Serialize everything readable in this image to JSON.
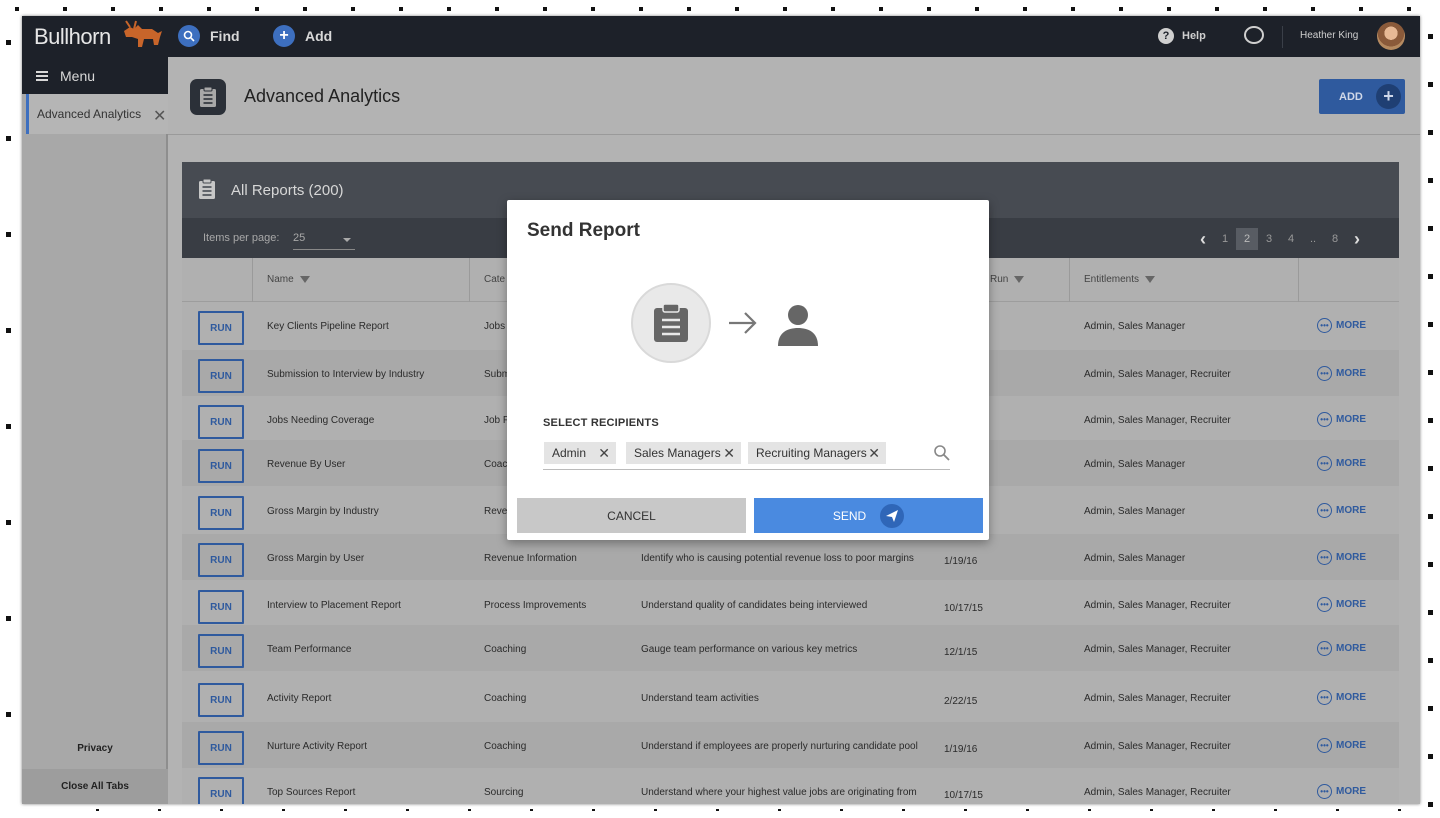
{
  "app": {
    "logo": "Bullhorn",
    "find_label": "Find",
    "add_label": "Add",
    "help_label": "Help",
    "user_name": "Heather King"
  },
  "sidebar": {
    "menu_label": "Menu",
    "active_tab": "Advanced Analytics",
    "privacy_label": "Privacy",
    "close_all_label": "Close All Tabs"
  },
  "header": {
    "title": "Advanced Analytics",
    "add_button": "ADD"
  },
  "panel": {
    "title": "All Reports (200)",
    "items_per_page_label": "Items per page:",
    "items_per_page_value": "25",
    "pager": {
      "pages": [
        "1",
        "2",
        "3",
        "4",
        "..",
        "8"
      ],
      "current": "2"
    },
    "columns": {
      "name": "Name",
      "category": "Cate",
      "last_run": "Run",
      "entitlements": "Entitlements"
    },
    "run_label": "RUN",
    "more_label": "MORE",
    "rows": [
      {
        "name": "Key Clients Pipeline Report",
        "category": "Jobs",
        "description": "",
        "last_run": "",
        "entitlements": "Admin, Sales Manager"
      },
      {
        "name": "Submission to Interview by Industry",
        "category": "Subm",
        "description": "",
        "last_run": "",
        "entitlements": "Admin, Sales Manager, Recruiter"
      },
      {
        "name": "Jobs Needing Coverage",
        "category": "Job F",
        "description": "",
        "last_run": "",
        "entitlements": "Admin, Sales Manager, Recruiter"
      },
      {
        "name": "Revenue By User",
        "category": "Coac",
        "description": "",
        "last_run": "",
        "entitlements": "Admin, Sales Manager"
      },
      {
        "name": "Gross Margin by Industry",
        "category": "Rever",
        "description": "",
        "last_run": "",
        "entitlements": "Admin, Sales Manager"
      },
      {
        "name": "Gross Margin by User",
        "category": "Revenue Information",
        "description": "Identify who is causing potential revenue loss to poor margins",
        "last_run": "1/19/16",
        "entitlements": "Admin, Sales Manager"
      },
      {
        "name": "Interview to Placement Report",
        "category": "Process Improvements",
        "description": "Understand quality of candidates being interviewed",
        "last_run": "10/17/15",
        "entitlements": "Admin, Sales Manager, Recruiter"
      },
      {
        "name": "Team Performance",
        "category": "Coaching",
        "description": "Gauge team performance on various key metrics",
        "last_run": "12/1/15",
        "entitlements": "Admin, Sales Manager, Recruiter"
      },
      {
        "name": "Activity Report",
        "category": "Coaching",
        "description": "Understand team activities",
        "last_run": "2/22/15",
        "entitlements": "Admin, Sales Manager, Recruiter"
      },
      {
        "name": "Nurture Activity Report",
        "category": "Coaching",
        "description": "Understand if employees are properly nurturing candidate pool",
        "last_run": "1/19/16",
        "entitlements": "Admin, Sales Manager, Recruiter"
      },
      {
        "name": "Top Sources Report",
        "category": "Sourcing",
        "description": "Understand where your highest value jobs are originating from",
        "last_run": "10/17/15",
        "entitlements": "Admin, Sales Manager, Recruiter"
      }
    ]
  },
  "modal": {
    "title": "Send Report",
    "recipients_label": "SELECT RECIPIENTS",
    "chips": [
      "Admin",
      "Sales Managers",
      "Recruiting Managers"
    ],
    "cancel_label": "CANCEL",
    "send_label": "SEND"
  },
  "colors": {
    "accent": "#2f5a9e",
    "send": "#4a8ae0",
    "topbar": "#1d2129"
  }
}
